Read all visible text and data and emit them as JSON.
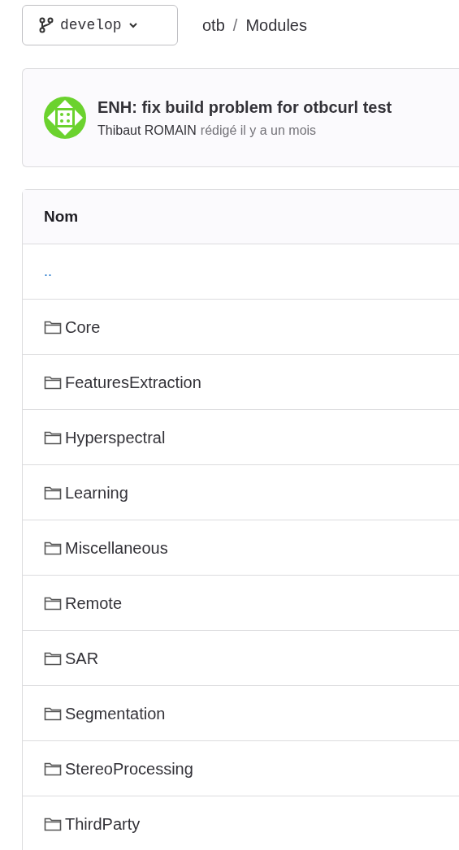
{
  "branch": {
    "name": "develop"
  },
  "breadcrumb": [
    "otb",
    "Modules"
  ],
  "breadcrumb_separator": "/",
  "commit": {
    "title": "ENH: fix build problem for otbcurl test",
    "author": "Thibaut ROMAIN",
    "time": "rédigé il y a un mois"
  },
  "table": {
    "columns": [
      "Nom"
    ],
    "rows": [
      {
        "kind": "parent",
        "name": ".."
      },
      {
        "kind": "folder",
        "name": "Core"
      },
      {
        "kind": "folder",
        "name": "FeaturesExtraction"
      },
      {
        "kind": "folder",
        "name": "Hyperspectral"
      },
      {
        "kind": "folder",
        "name": "Learning"
      },
      {
        "kind": "folder",
        "name": "Miscellaneous"
      },
      {
        "kind": "folder",
        "name": "Remote"
      },
      {
        "kind": "folder",
        "name": "SAR"
      },
      {
        "kind": "folder",
        "name": "Segmentation"
      },
      {
        "kind": "folder",
        "name": "StereoProcessing"
      },
      {
        "kind": "folder",
        "name": "ThirdParty"
      }
    ]
  }
}
